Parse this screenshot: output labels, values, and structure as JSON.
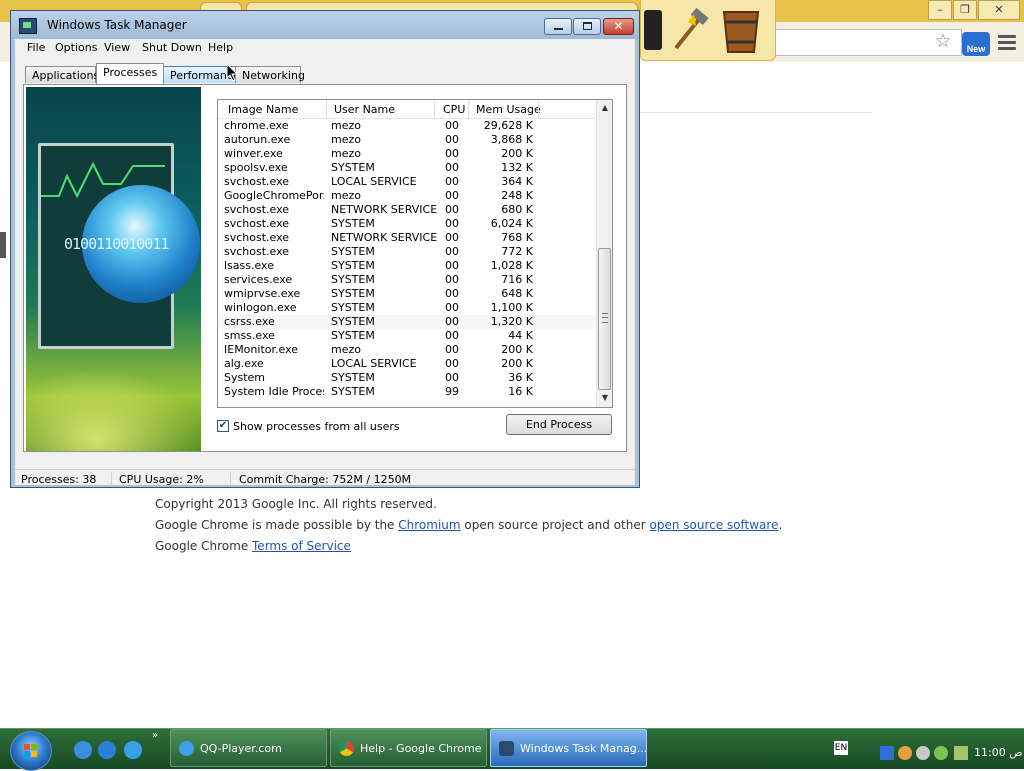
{
  "task_manager": {
    "title": "Windows Task Manager",
    "menu": [
      "File",
      "Options",
      "View",
      "Shut Down",
      "Help"
    ],
    "tabs": [
      "Applications",
      "Processes",
      "Performance",
      "Networking"
    ],
    "active_tab": "Processes",
    "art_binary": "0100110010011",
    "columns": [
      "Image Name",
      "User Name",
      "CPU",
      "Mem Usage"
    ],
    "processes": [
      {
        "name": "chrome.exe",
        "user": "mezo",
        "cpu": "00",
        "mem": "29,628 K"
      },
      {
        "name": "autorun.exe",
        "user": "mezo",
        "cpu": "00",
        "mem": "3,868 K"
      },
      {
        "name": "winver.exe",
        "user": "mezo",
        "cpu": "00",
        "mem": "200 K"
      },
      {
        "name": "spoolsv.exe",
        "user": "SYSTEM",
        "cpu": "00",
        "mem": "132 K"
      },
      {
        "name": "svchost.exe",
        "user": "LOCAL SERVICE",
        "cpu": "00",
        "mem": "364 K"
      },
      {
        "name": "GoogleChromePor...",
        "user": "mezo",
        "cpu": "00",
        "mem": "248 K"
      },
      {
        "name": "svchost.exe",
        "user": "NETWORK SERVICE",
        "cpu": "00",
        "mem": "680 K"
      },
      {
        "name": "svchost.exe",
        "user": "SYSTEM",
        "cpu": "00",
        "mem": "6,024 K"
      },
      {
        "name": "svchost.exe",
        "user": "NETWORK SERVICE",
        "cpu": "00",
        "mem": "768 K"
      },
      {
        "name": "svchost.exe",
        "user": "SYSTEM",
        "cpu": "00",
        "mem": "772 K"
      },
      {
        "name": "lsass.exe",
        "user": "SYSTEM",
        "cpu": "00",
        "mem": "1,028 K"
      },
      {
        "name": "services.exe",
        "user": "SYSTEM",
        "cpu": "00",
        "mem": "716 K"
      },
      {
        "name": "wmiprvse.exe",
        "user": "SYSTEM",
        "cpu": "00",
        "mem": "648 K"
      },
      {
        "name": "winlogon.exe",
        "user": "SYSTEM",
        "cpu": "00",
        "mem": "1,100 K"
      },
      {
        "name": "csrss.exe",
        "user": "SYSTEM",
        "cpu": "00",
        "mem": "1,320 K"
      },
      {
        "name": "smss.exe",
        "user": "SYSTEM",
        "cpu": "00",
        "mem": "44 K"
      },
      {
        "name": "IEMonitor.exe",
        "user": "mezo",
        "cpu": "00",
        "mem": "200 K"
      },
      {
        "name": "alg.exe",
        "user": "LOCAL SERVICE",
        "cpu": "00",
        "mem": "200 K"
      },
      {
        "name": "System",
        "user": "SYSTEM",
        "cpu": "00",
        "mem": "36 K"
      },
      {
        "name": "System Idle Process",
        "user": "SYSTEM",
        "cpu": "99",
        "mem": "16 K"
      }
    ],
    "show_all_label": "Show processes from all users",
    "show_all_checked": true,
    "end_process_label": "End Process",
    "status": {
      "processes": "Processes: 38",
      "cpu": "CPU Usage: 2%",
      "commit": "Commit Charge: 752M / 1250M"
    }
  },
  "chrome_page": {
    "copyright": "Copyright 2013 Google Inc. All rights reserved.",
    "made_possible_prefix": "Google Chrome is made possible by the ",
    "chromium_link": "Chromium",
    "made_possible_mid": " open source project and other ",
    "oss_link": "open source software",
    "made_possible_suffix": ".",
    "tos_prefix": "Google Chrome ",
    "tos_link": "Terms of Service",
    "new_badge": "New"
  },
  "taskbar": {
    "items": [
      {
        "label": "QQ-Player.com",
        "icon": "qq-player-icon"
      },
      {
        "label": "Help - Google Chrome",
        "icon": "chrome-icon"
      },
      {
        "label": "Windows Task Manag...",
        "icon": "task-manager-icon"
      }
    ],
    "active_index": 2,
    "language": "EN",
    "clock": "11:00 ص"
  }
}
